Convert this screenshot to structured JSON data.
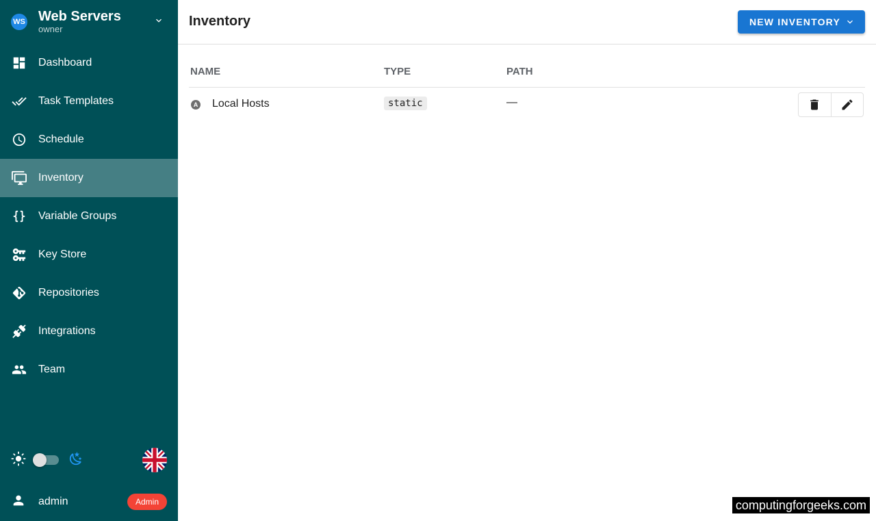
{
  "project": {
    "initials": "WS",
    "name": "Web Servers",
    "role": "owner"
  },
  "nav": [
    {
      "label": "Dashboard",
      "icon": "dashboard-icon",
      "active": false
    },
    {
      "label": "Task Templates",
      "icon": "double-check-icon",
      "active": false
    },
    {
      "label": "Schedule",
      "icon": "clock-icon",
      "active": false
    },
    {
      "label": "Inventory",
      "icon": "monitor-multiple-icon",
      "active": true
    },
    {
      "label": "Variable Groups",
      "icon": "code-braces-icon",
      "active": false
    },
    {
      "label": "Key Store",
      "icon": "key-change-icon",
      "active": false
    },
    {
      "label": "Repositories",
      "icon": "git-icon",
      "active": false
    },
    {
      "label": "Integrations",
      "icon": "plug-icon",
      "active": false
    },
    {
      "label": "Team",
      "icon": "account-multiple-icon",
      "active": false
    }
  ],
  "theme": {
    "dark_mode": false
  },
  "user": {
    "name": "admin",
    "badge": "Admin"
  },
  "header": {
    "title": "Inventory",
    "new_button_label": "NEW INVENTORY"
  },
  "table": {
    "columns": [
      "NAME",
      "TYPE",
      "PATH"
    ],
    "rows": [
      {
        "icon_letter": "A",
        "name": "Local Hosts",
        "type": "static",
        "path": "—"
      }
    ]
  },
  "watermark": "computingforgeeks.com",
  "colors": {
    "sidebar": "#005057",
    "primary": "#1976d2",
    "badge": "#f44336"
  }
}
